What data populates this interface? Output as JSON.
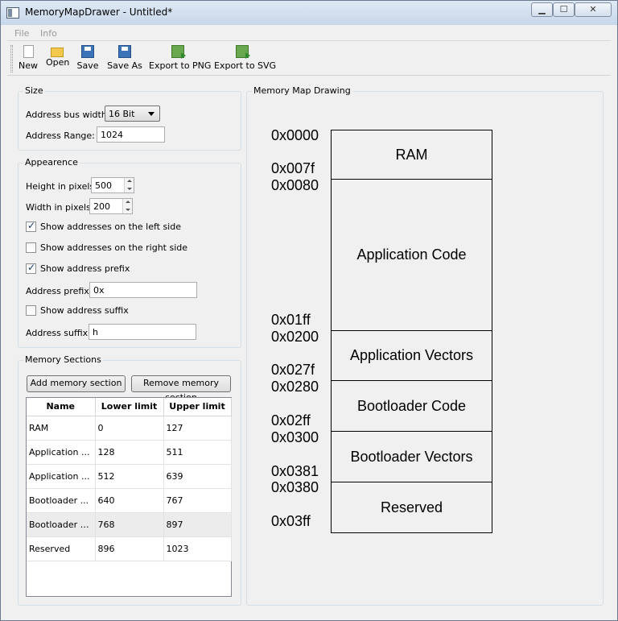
{
  "window": {
    "title": "MemoryMapDrawer - Untitled*",
    "minimize_glyph": "▁",
    "maximize_glyph": "☐",
    "close_glyph": "✕"
  },
  "menu": {
    "file": "File",
    "info": "Info"
  },
  "toolbar": {
    "new": "New",
    "open": "Open",
    "save": "Save",
    "save_as": "Save As",
    "export_png": "Export to PNG",
    "export_svg": "Export to SVG"
  },
  "size_group": {
    "title": "Size",
    "bus_width_label": "Address bus width:",
    "bus_width_value": "16 Bit",
    "range_label": "Address Range:",
    "range_value": "1024"
  },
  "appearance_group": {
    "title": "Appearence",
    "height_label": "Height in pixels:",
    "height_value": "500",
    "width_label": "Width in pixels:",
    "width_value": "200",
    "show_left_label": "Show addresses on the left side",
    "show_left_checked": true,
    "show_right_label": "Show addresses on the right side",
    "show_right_checked": false,
    "show_prefix_label": "Show address prefix",
    "show_prefix_checked": true,
    "prefix_label": "Address prefix:",
    "prefix_value": "0x",
    "show_suffix_label": "Show address suffix",
    "show_suffix_checked": false,
    "suffix_label": "Address suffix:",
    "suffix_value": "h"
  },
  "sections_group": {
    "title": "Memory Sections",
    "add_button": "Add memory section",
    "remove_button": "Remove memory section",
    "columns": [
      "Name",
      "Lower limit",
      "Upper limit"
    ],
    "rows": [
      {
        "name": "RAM",
        "lower": "0",
        "upper": "127"
      },
      {
        "name": "Application ...",
        "lower": "128",
        "upper": "511"
      },
      {
        "name": "Application ...",
        "lower": "512",
        "upper": "639"
      },
      {
        "name": "Bootloader ...",
        "lower": "640",
        "upper": "767"
      },
      {
        "name": "Bootloader V...",
        "lower": "768",
        "upper": "897",
        "selected": true
      },
      {
        "name": "Reserved",
        "lower": "896",
        "upper": "1023"
      }
    ]
  },
  "drawing": {
    "title": "Memory Map Drawing",
    "sections": [
      {
        "label": "RAM",
        "start": "0x0000",
        "end": "0x007f"
      },
      {
        "label": "Application Code",
        "start": "0x0080",
        "end": "0x01ff"
      },
      {
        "label": "Application Vectors",
        "start": "0x0200",
        "end": "0x027f"
      },
      {
        "label": "Bootloader Code",
        "start": "0x0280",
        "end": "0x02ff"
      },
      {
        "label": "Bootloader Vectors",
        "start": "0x0300",
        "end": "0x0381"
      },
      {
        "label": "Reserved",
        "start": "0x0380",
        "end": "0x03ff"
      }
    ]
  }
}
